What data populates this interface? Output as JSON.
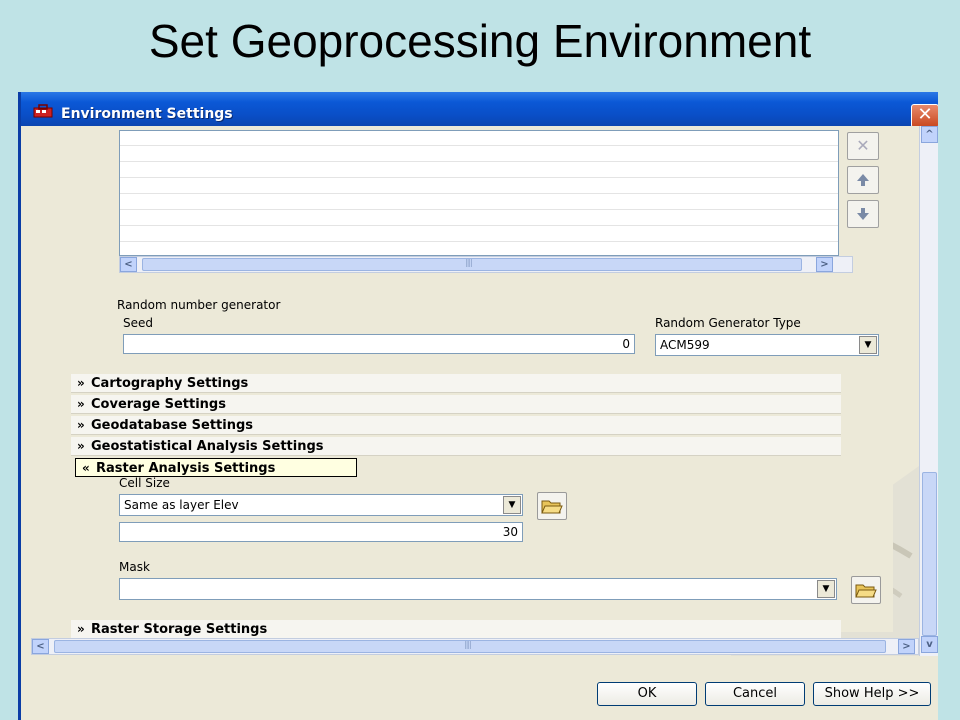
{
  "slide": {
    "title": "Set Geoprocessing Environment"
  },
  "window": {
    "title": "Environment Settings",
    "close_glyph": "✕"
  },
  "icons": {
    "app": "toolbox-icon",
    "remove": "remove-x-icon",
    "up": "arrow-up-icon",
    "down": "arrow-down-icon",
    "folder": "open-folder-icon"
  },
  "random": {
    "group_label": "Random number generator",
    "seed_label": "Seed",
    "seed_value": "0",
    "type_label": "Random Generator Type",
    "type_value": "ACM599"
  },
  "sections": [
    {
      "label": "Cartography Settings",
      "expanded": false
    },
    {
      "label": "Coverage Settings",
      "expanded": false
    },
    {
      "label": "Geodatabase Settings",
      "expanded": false
    },
    {
      "label": "Geostatistical Analysis Settings",
      "expanded": false
    },
    {
      "label": "Raster Analysis Settings",
      "expanded": true
    },
    {
      "label": "Raster Storage Settings",
      "expanded": false
    }
  ],
  "raster": {
    "cell_size_label": "Cell Size",
    "cell_size_value": "Same as layer Elev",
    "cell_size_number": "30",
    "mask_label": "Mask",
    "mask_value": ""
  },
  "buttons": {
    "ok": "OK",
    "cancel": "Cancel",
    "help": "Show Help >>"
  },
  "colors": {
    "titlebar": "#0b58d6",
    "highlight": "#ffffe1",
    "dialog": "#ece9d8"
  }
}
